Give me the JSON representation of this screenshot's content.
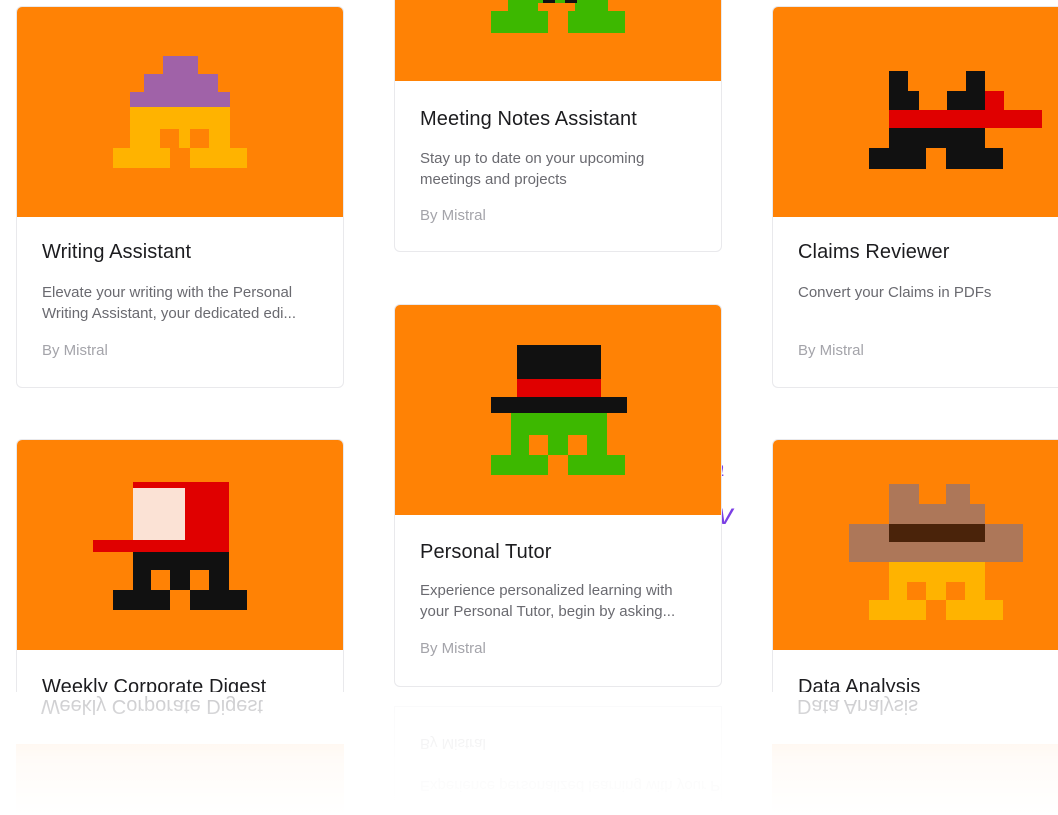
{
  "cards": [
    {
      "title": "Writing Assistant",
      "description": "Elevate your writing with the Personal Writing Assistant, your dedicated edi...",
      "author": "By Mistral"
    },
    {
      "title": "Meeting Notes Assistant",
      "description": "Stay up to date on your upcoming meetings and projects",
      "author": "By Mistral"
    },
    {
      "title": "Claims Reviewer",
      "description": "Convert your Claims in PDFs",
      "author": "By Mistral"
    },
    {
      "title": "Weekly Corporate Digest"
    },
    {
      "title": "Personal Tutor",
      "description": "Experience personalized learning with your Personal Tutor, begin by asking...",
      "author": "By Mistral"
    },
    {
      "title": "Data Analysis"
    }
  ],
  "colors": {
    "card_art_bg": "#ff8205",
    "accent": "#7b3fe4"
  },
  "icons": [
    "purple-hat-yellow-avatar-icon",
    "green-avatar-icon",
    "black-ninja-red-headband-icon",
    "red-cap-black-avatar-icon",
    "top-hat-green-avatar-icon",
    "cowboy-hat-yellow-avatar-icon"
  ]
}
